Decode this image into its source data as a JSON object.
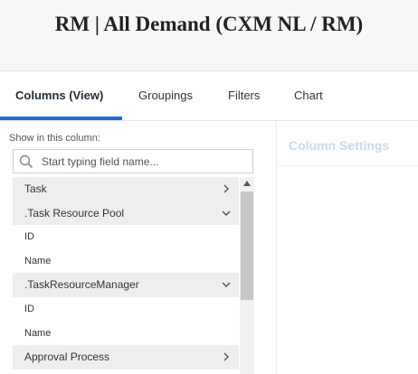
{
  "header": {
    "title": "RM | All Demand (CXM NL / RM)"
  },
  "tabs": [
    {
      "label": "Columns (View)",
      "active": true
    },
    {
      "label": "Groupings"
    },
    {
      "label": "Filters"
    },
    {
      "label": "Chart"
    }
  ],
  "left_panel": {
    "show_label": "Show in this column:",
    "search": {
      "placeholder": "Start typing field name...",
      "value": "",
      "icon": "search-icon"
    },
    "items": [
      {
        "label": "Task",
        "type": "group",
        "chevron": "chevron-right-icon"
      },
      {
        "label": ".Task Resource Pool",
        "type": "group",
        "chevron": "chevron-down-icon"
      },
      {
        "label": "ID",
        "type": "field"
      },
      {
        "label": "Name",
        "type": "field"
      },
      {
        "label": ".TaskResourceManager",
        "type": "group",
        "chevron": "chevron-down-icon"
      },
      {
        "label": "ID",
        "type": "field"
      },
      {
        "label": "Name",
        "type": "field"
      },
      {
        "label": "Approval Process",
        "type": "group",
        "chevron": "chevron-right-icon"
      }
    ]
  },
  "right_panel": {
    "title": "Column Settings"
  },
  "colors": {
    "accent": "#1c6ed1",
    "header_bg": "#f7f7f7",
    "group_row_bg": "#eeeeee",
    "settings_title": "#c6dced",
    "scrollbar_thumb": "#c7c7c7"
  }
}
